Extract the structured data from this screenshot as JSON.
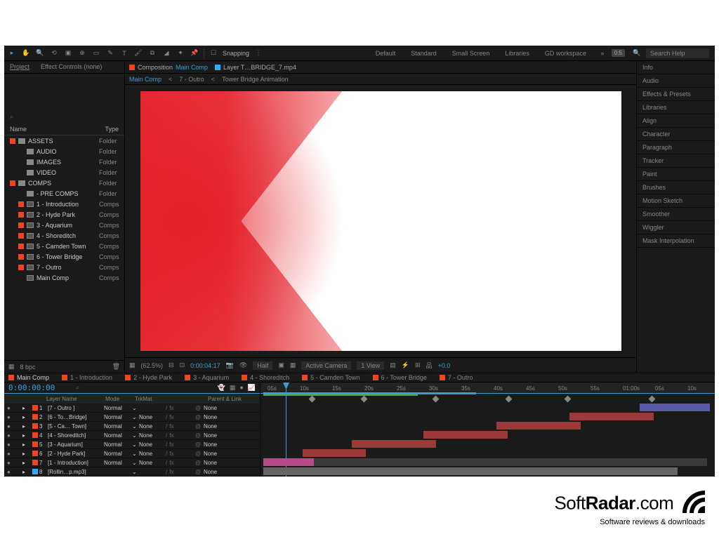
{
  "toolbar": {
    "snapping": "Snapping"
  },
  "workspaces": [
    "Default",
    "Standard",
    "Small Screen",
    "Libraries",
    "GD workspace"
  ],
  "searchHelp": "Search Help",
  "kbdIcon": "0:5",
  "leftPanel": {
    "tabs": {
      "project": "Project",
      "effectControls": "Effect Controls (none)"
    },
    "header": {
      "name": "Name",
      "type": "Type"
    },
    "tree": [
      {
        "color": "#e42",
        "icon": "folder",
        "name": "ASSETS",
        "type": "Folder",
        "indent": 0
      },
      {
        "color": "",
        "icon": "folder",
        "name": "AUDIO",
        "type": "Folder",
        "indent": 1
      },
      {
        "color": "",
        "icon": "folder",
        "name": "IMAGES",
        "type": "Folder",
        "indent": 1
      },
      {
        "color": "",
        "icon": "folder",
        "name": "VIDEO",
        "type": "Folder",
        "indent": 1
      },
      {
        "color": "#e42",
        "icon": "folder",
        "name": "COMPS",
        "type": "Folder",
        "indent": 0
      },
      {
        "color": "",
        "icon": "folder",
        "name": "- PRE COMPS",
        "type": "Folder",
        "indent": 1
      },
      {
        "color": "#e42",
        "icon": "comp",
        "name": "1 - Introduction",
        "type": "Comps",
        "indent": 1
      },
      {
        "color": "#e42",
        "icon": "comp",
        "name": "2 - Hyde Park",
        "type": "Comps",
        "indent": 1
      },
      {
        "color": "#e42",
        "icon": "comp",
        "name": "3 - Aquarium",
        "type": "Comps",
        "indent": 1
      },
      {
        "color": "#e42",
        "icon": "comp",
        "name": "4 - Shoreditch",
        "type": "Comps",
        "indent": 1
      },
      {
        "color": "#e42",
        "icon": "comp",
        "name": "5 - Camden Town",
        "type": "Comps",
        "indent": 1
      },
      {
        "color": "#e42",
        "icon": "comp",
        "name": "6 - Tower Bridge",
        "type": "Comps",
        "indent": 1
      },
      {
        "color": "#e42",
        "icon": "comp",
        "name": "7 - Outro",
        "type": "Comps",
        "indent": 1
      },
      {
        "color": "",
        "icon": "comp",
        "name": "Main Comp",
        "type": "Comps",
        "indent": 1
      }
    ]
  },
  "compTabs": {
    "composition": "Composition",
    "activeComp": "Main Comp",
    "layerTab": "Layer T…BRIDGE_7.mp4"
  },
  "breadcrumbs": [
    {
      "label": "Main Comp",
      "active": true
    },
    {
      "label": "7 - Outro",
      "active": false
    },
    {
      "label": "Tower Bridge Animation",
      "active": false
    }
  ],
  "viewerBar": {
    "zoom": "(62.5%)",
    "time": "0:00:04:17",
    "res": "Half",
    "camera": "Active Camera",
    "views": "1 View",
    "plus": "+0.0"
  },
  "rightPanel": [
    "Info",
    "Audio",
    "Effects & Presets",
    "Libraries",
    "Align",
    "Character",
    "Paragraph",
    "Tracker",
    "Paint",
    "Brushes",
    "Motion Sketch",
    "Smoother",
    "Wiggler",
    "Mask Interpolation"
  ],
  "timelineTabs": [
    {
      "color": "#e42",
      "label": "Main Comp",
      "active": true
    },
    {
      "color": "#e42",
      "label": "1 - Introduction"
    },
    {
      "color": "#e42",
      "label": "2 - Hyde Park"
    },
    {
      "color": "#e42",
      "label": "3 - Aquarium"
    },
    {
      "color": "#e42",
      "label": "4 - Shoreditch"
    },
    {
      "color": "#e42",
      "label": "5 - Camden Town"
    },
    {
      "color": "#e42",
      "label": "6 - Tower Bridge"
    },
    {
      "color": "#e42",
      "label": "7 - Outro"
    }
  ],
  "timecode": "0:00:00:00",
  "layerHeader": {
    "name": "Layer Name",
    "mode": "Mode",
    "track": "TrkMat",
    "parent": "Parent & Link"
  },
  "layers": [
    {
      "num": "1",
      "color": "#e42",
      "name": "[7 - Outro ]",
      "mode": "Normal",
      "track": "",
      "parent": "None"
    },
    {
      "num": "2",
      "color": "#e42",
      "name": "[6 - To…Bridge]",
      "mode": "Normal",
      "track": "None",
      "parent": "None"
    },
    {
      "num": "3",
      "color": "#e42",
      "name": "[5 - Ca… Town]",
      "mode": "Normal",
      "track": "None",
      "parent": "None"
    },
    {
      "num": "4",
      "color": "#e42",
      "name": "[4 - Shoreditch]",
      "mode": "Normal",
      "track": "None",
      "parent": "None"
    },
    {
      "num": "5",
      "color": "#e42",
      "name": "[3 - Aquarium]",
      "mode": "Normal",
      "track": "None",
      "parent": "None"
    },
    {
      "num": "6",
      "color": "#e42",
      "name": "[2 - Hyde Park]",
      "mode": "Normal",
      "track": "None",
      "parent": "None"
    },
    {
      "num": "7",
      "color": "#e42",
      "name": "[1 - Introduction]",
      "mode": "Normal",
      "track": "None",
      "parent": "None"
    },
    {
      "num": "8",
      "color": "#3af",
      "name": "[Rollin…p.mp3]",
      "mode": "",
      "track": "",
      "parent": "None"
    }
  ],
  "rulerTicks": [
    "05s",
    "10s",
    "15s",
    "20s",
    "25s",
    "30s",
    "35s",
    "40s",
    "45s",
    "50s",
    "55s",
    "01:00s",
    "05s",
    "10s"
  ],
  "watermark": {
    "brand1": "Soft",
    "brand2": "Radar",
    "suffix": ".com",
    "sub": "Software reviews & downloads"
  },
  "infoBar": {
    "bpc": "8 bpc"
  }
}
